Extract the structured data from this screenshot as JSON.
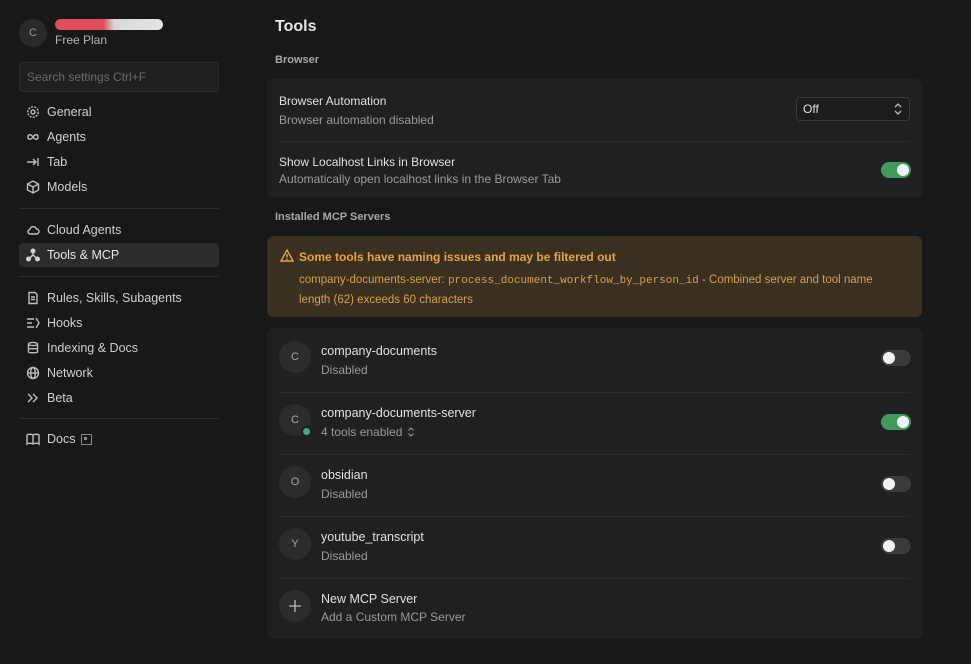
{
  "profile": {
    "initial": "C",
    "plan": "Free Plan"
  },
  "search": {
    "placeholder": "Search settings Ctrl+F"
  },
  "sidebar": {
    "items": [
      {
        "label": "General"
      },
      {
        "label": "Agents"
      },
      {
        "label": "Tab"
      },
      {
        "label": "Models"
      },
      {
        "label": "Cloud Agents"
      },
      {
        "label": "Tools & MCP"
      },
      {
        "label": "Rules, Skills, Subagents"
      },
      {
        "label": "Hooks"
      },
      {
        "label": "Indexing & Docs"
      },
      {
        "label": "Network"
      },
      {
        "label": "Beta"
      },
      {
        "label": "Docs"
      }
    ]
  },
  "main": {
    "title": "Tools",
    "browser_section": "Browser",
    "browser_automation": {
      "title": "Browser Automation",
      "subtitle": "Browser automation disabled",
      "value": "Off"
    },
    "localhost_links": {
      "title": "Show Localhost Links in Browser",
      "subtitle": "Automatically open localhost links in the Browser Tab",
      "enabled": true
    },
    "mcp_section": "Installed MCP Servers",
    "warning": {
      "title": "Some tools have naming issues and may be filtered out",
      "server": "company-documents-server:",
      "tool": "process_document_workflow_by_person_id",
      "message": "- Combined server and tool name length (62) exceeds 60 characters"
    },
    "servers": [
      {
        "initial": "C",
        "name": "company-documents",
        "status": "Disabled",
        "enabled": false
      },
      {
        "initial": "C",
        "name": "company-documents-server",
        "status": "4 tools enabled",
        "enabled": true
      },
      {
        "initial": "O",
        "name": "obsidian",
        "status": "Disabled",
        "enabled": false
      },
      {
        "initial": "Y",
        "name": "youtube_transcript",
        "status": "Disabled",
        "enabled": false
      }
    ],
    "new_server": {
      "title": "New MCP Server",
      "subtitle": "Add a Custom MCP Server"
    }
  },
  "colors": {
    "accent_on": "#3f9b5a",
    "warning_bg": "#3a3020",
    "warning_text": "#e6a34a"
  }
}
